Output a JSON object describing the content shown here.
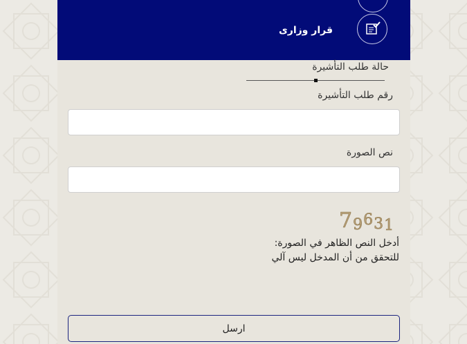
{
  "header": {
    "title": "قرار وزارى",
    "icon": "document-check-icon",
    "background_color": "#020b78"
  },
  "form": {
    "status_label": "حالة طلب التأشيرة",
    "request_number_label": "رقم طلب التأشيرة",
    "request_number_value": "",
    "image_text_label": "نص الصورة",
    "image_text_value": "",
    "captcha_value": "79631",
    "captcha_instruction_line1": "أدخل النص الظاهر في الصورة:",
    "captcha_instruction_line2": "للتحقق من أن المدخل ليس آلي",
    "submit_label": "ارسل"
  }
}
